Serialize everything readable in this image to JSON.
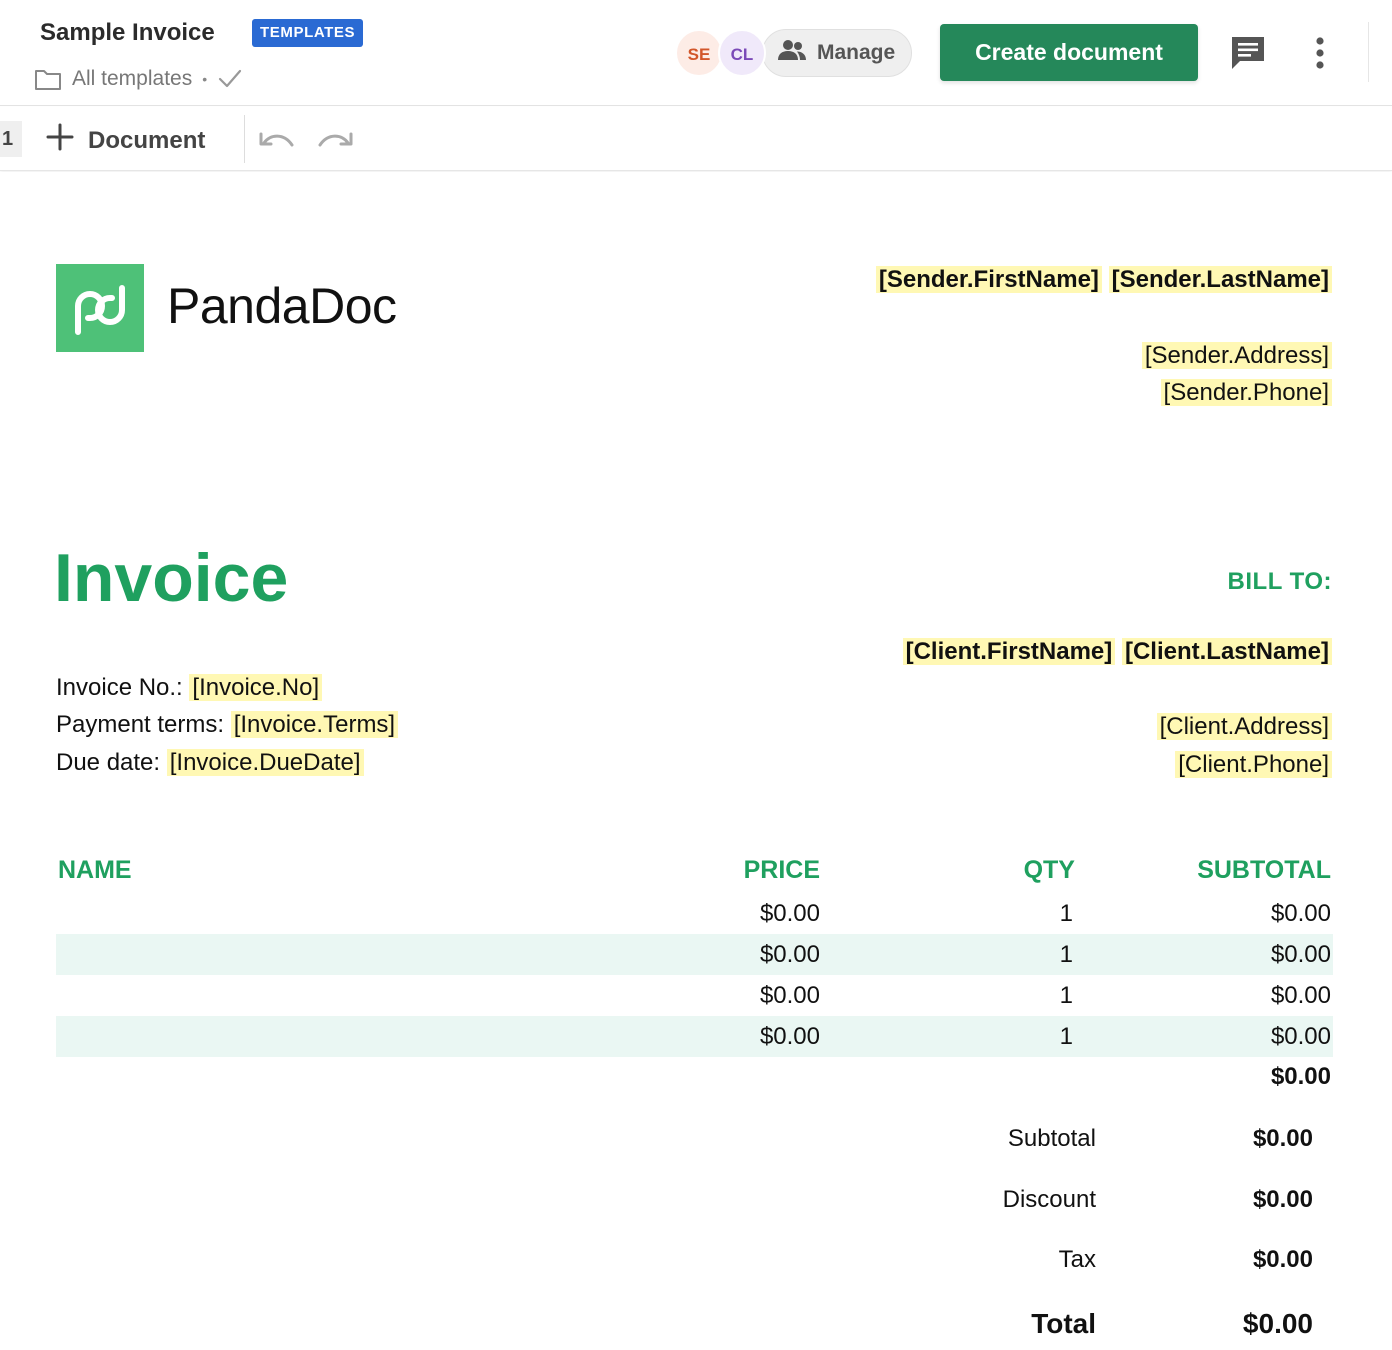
{
  "header": {
    "title": "Sample Invoice",
    "badge": "TEMPLATES",
    "breadcrumb": "All templates",
    "breadcrumb_sep": "•",
    "avatars": [
      "SE",
      "CL"
    ],
    "manage_label": "Manage",
    "create_label": "Create document"
  },
  "toolbar": {
    "page_number": "1",
    "document_label": "Document"
  },
  "colors": {
    "accent": "#1fa05f",
    "button": "#25885a",
    "badge": "#2a6ad3",
    "highlight": "#fff8b4",
    "row_alt": "#eaf7f3",
    "logo": "#4ec178"
  },
  "icons": [
    "folder-icon",
    "check-icon",
    "people-icon",
    "comment-icon",
    "more-vertical-icon",
    "plus-icon",
    "undo-icon",
    "redo-icon",
    "pandadoc-logo-icon"
  ],
  "document": {
    "logo_text": "PandaDoc",
    "sender": {
      "first_name": "[Sender.FirstName]",
      "last_name": "[Sender.LastName]",
      "address": "[Sender.Address]",
      "phone": "[Sender.Phone]"
    },
    "heading": "Invoice",
    "bill_to_label": "BILL TO:",
    "client": {
      "first_name": "[Client.FirstName]",
      "last_name": "[Client.LastName]",
      "address": "[Client.Address]",
      "phone": "[Client.Phone]"
    },
    "invoice_fields": [
      {
        "label": "Invoice No.:",
        "value": "[Invoice.No]"
      },
      {
        "label": "Payment terms:",
        "value": "[Invoice.Terms]"
      },
      {
        "label": "Due date:",
        "value": "[Invoice.DueDate]"
      }
    ],
    "table": {
      "headers": [
        "NAME",
        "PRICE",
        "QTY",
        "SUBTOTAL"
      ],
      "rows": [
        {
          "name": "",
          "price": "$0.00",
          "qty": "1",
          "subtotal": "$0.00"
        },
        {
          "name": "",
          "price": "$0.00",
          "qty": "1",
          "subtotal": "$0.00"
        },
        {
          "name": "",
          "price": "$0.00",
          "qty": "1",
          "subtotal": "$0.00"
        },
        {
          "name": "",
          "price": "$0.00",
          "qty": "1",
          "subtotal": "$0.00"
        }
      ],
      "total": "$0.00"
    },
    "summary": [
      {
        "label": "Subtotal",
        "value": "$0.00"
      },
      {
        "label": "Discount",
        "value": "$0.00"
      },
      {
        "label": "Tax",
        "value": "$0.00"
      },
      {
        "label": "Total",
        "value": "$0.00"
      }
    ]
  }
}
